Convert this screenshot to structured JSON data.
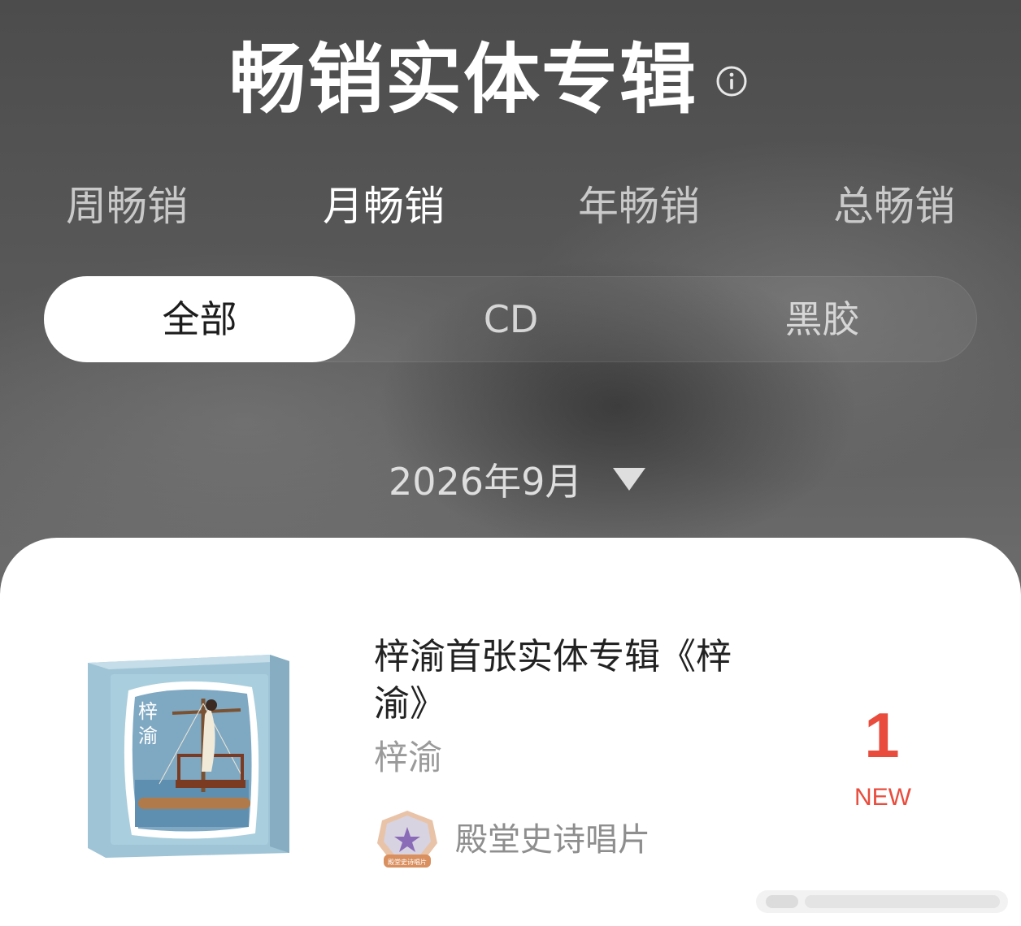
{
  "header": {
    "title": "畅销实体专辑",
    "info_icon": "info-icon"
  },
  "period_tabs": [
    {
      "label": "周畅销",
      "active": false
    },
    {
      "label": "月畅销",
      "active": true
    },
    {
      "label": "年畅销",
      "active": false
    },
    {
      "label": "总畅销",
      "active": false
    }
  ],
  "format_tabs": [
    {
      "label": "全部",
      "active": true
    },
    {
      "label": "CD",
      "active": false
    },
    {
      "label": "黑胶",
      "active": false
    }
  ],
  "date_picker": {
    "value": "2026年9月",
    "icon": "caret-down-icon"
  },
  "chart_item": {
    "title": "梓渝首张实体专辑《梓渝》",
    "artist": "梓渝",
    "badge": {
      "label": "殿堂史诗唱片",
      "icon": "hall-of-fame-badge-icon",
      "inner_text": "殿堂史诗唱片"
    },
    "rank": "1",
    "rank_tag": "NEW",
    "cover_text": "梓渝"
  },
  "colors": {
    "accent": "#e94c3d",
    "card": "#ffffff",
    "title": "#ffffff"
  }
}
